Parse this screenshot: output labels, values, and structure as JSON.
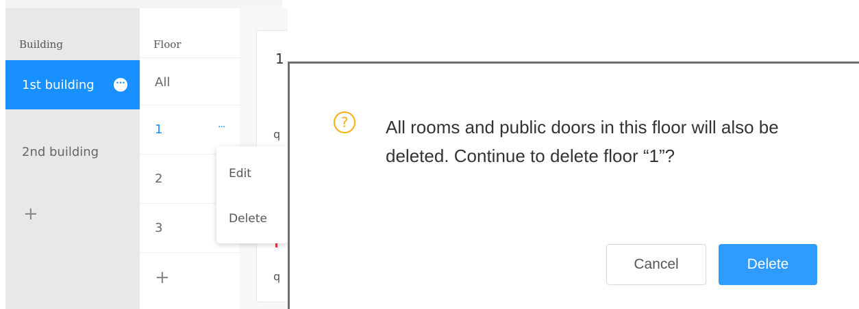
{
  "building_panel": {
    "header": "Building",
    "items": [
      {
        "label": "1st building",
        "active": true
      },
      {
        "label": "2nd building",
        "active": false
      }
    ],
    "add_symbol": "+"
  },
  "floor_panel": {
    "header": "Floor",
    "items": [
      {
        "label": "All"
      },
      {
        "label": "1",
        "active": true
      },
      {
        "label": "2"
      },
      {
        "label": "3"
      }
    ],
    "more_symbol": "···",
    "add_symbol": "+"
  },
  "content_partial": {
    "title_fragment": "1",
    "row_fragment_a": "q",
    "row_fragment_b": "q"
  },
  "context_menu": {
    "edit_label": "Edit",
    "delete_label": "Delete"
  },
  "dialog": {
    "icon": "question-circle-icon",
    "icon_glyph": "?",
    "message": "All rooms and public doors in this floor will also be deleted. Continue to delete floor “1”?",
    "cancel_label": "Cancel",
    "delete_label": "Delete"
  },
  "colors": {
    "accent": "#1890ff",
    "warning": "#faad14",
    "primary_button": "#2f9bff"
  }
}
